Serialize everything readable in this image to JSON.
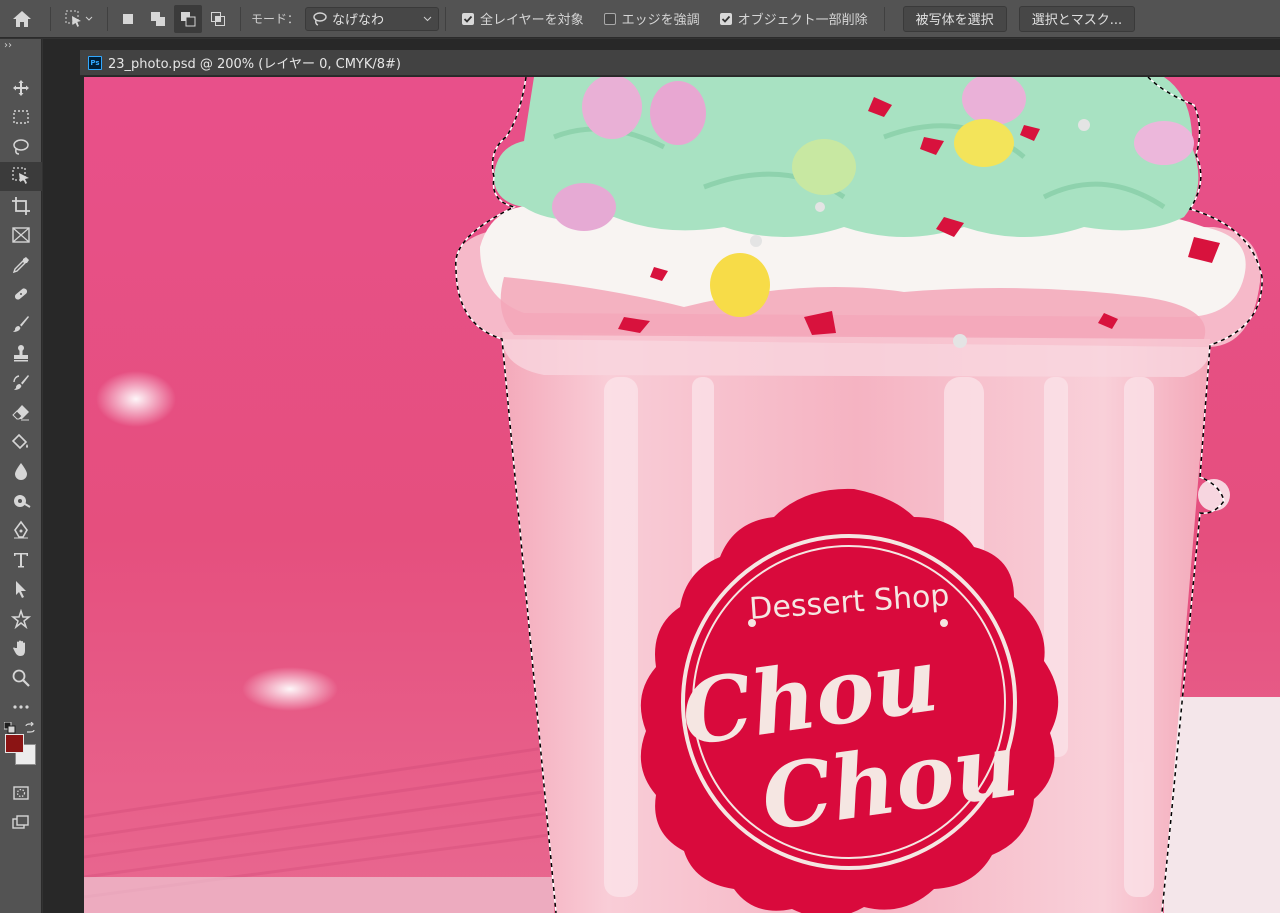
{
  "options_bar": {
    "mode_label": "モード：",
    "mode_value": "なげなわ",
    "checkbox_all_layers": "全レイヤーを対象",
    "checkbox_enhance_edge": "エッジを強調",
    "checkbox_object_subtract": "オブジェクト一部削除",
    "btn_select_subject": "被写体を選択",
    "btn_select_mask": "選択とマスク..."
  },
  "toolbar": {
    "collapse": "››",
    "tools": [
      {
        "name": "move-tool",
        "icon": "move-icon"
      },
      {
        "name": "marquee-tool",
        "icon": "rect-marquee-icon"
      },
      {
        "name": "lasso-tool",
        "icon": "lasso-icon"
      },
      {
        "name": "object-selection-tool",
        "icon": "object-selection-icon",
        "active": true
      },
      {
        "name": "crop-tool",
        "icon": "crop-icon"
      },
      {
        "name": "frame-tool",
        "icon": "frame-icon"
      },
      {
        "name": "eyedropper-tool",
        "icon": "eyedropper-icon"
      },
      {
        "name": "healing-brush-tool",
        "icon": "bandage-icon"
      },
      {
        "name": "brush-tool",
        "icon": "brush-icon"
      },
      {
        "name": "clone-stamp-tool",
        "icon": "stamp-icon"
      },
      {
        "name": "history-brush-tool",
        "icon": "history-brush-icon"
      },
      {
        "name": "eraser-tool",
        "icon": "eraser-icon"
      },
      {
        "name": "paint-bucket-tool",
        "icon": "paint-bucket-icon"
      },
      {
        "name": "blur-tool",
        "icon": "drop-icon"
      },
      {
        "name": "dodge-tool",
        "icon": "dodge-icon"
      },
      {
        "name": "pen-tool",
        "icon": "pen-icon"
      },
      {
        "name": "type-tool",
        "icon": "type-icon"
      },
      {
        "name": "path-selection-tool",
        "icon": "arrow-icon"
      },
      {
        "name": "shape-tool",
        "icon": "shape-icon"
      },
      {
        "name": "hand-tool",
        "icon": "hand-icon"
      },
      {
        "name": "zoom-tool",
        "icon": "zoom-icon"
      },
      {
        "name": "more-tools",
        "icon": "more-icon"
      }
    ],
    "foreground_color": "#8b1414",
    "background_color": "#ececec"
  },
  "document": {
    "tab_title": "23_photo.psd @ 200% (レイヤー 0, CMYK/8#)",
    "badge": "Ps"
  },
  "canvas_image": {
    "sticker_top_text": "Dessert Shop",
    "sticker_line1": "Chou",
    "sticker_line2": "Chou",
    "background_color": "#e8507f",
    "cup_color": "#f6b9c6",
    "cream_color": "#a9e3c4",
    "sticker_color": "#d90a3c"
  }
}
